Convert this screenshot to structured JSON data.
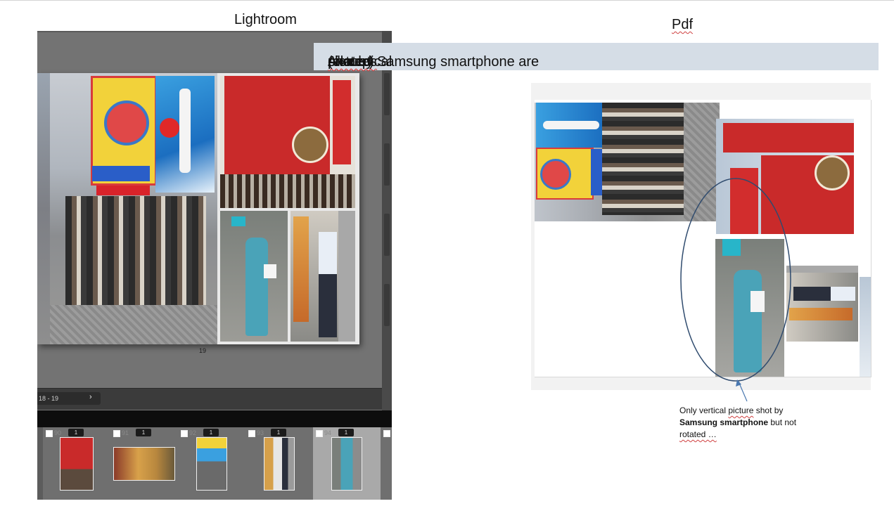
{
  "headings": {
    "lightroom": "Lightroom",
    "pdf": "Pdf"
  },
  "banner": {
    "text_before": "All vertical ",
    "text_squiggle1": "pictures",
    "text_mid": " shot by Samsung smartphone are ",
    "text_squiggle2": "rotated",
    "text_space": " ",
    "text_squiggle3": "(except",
    "text_after": " one …)"
  },
  "lightroom": {
    "page_number": "19",
    "page_nav": "18  -  19",
    "page_nav_arrow": "›",
    "filmstrip": [
      {
        "num": "90",
        "badge": "1",
        "selected": false
      },
      {
        "num": "91",
        "badge": "1",
        "selected": false
      },
      {
        "num": "92",
        "badge": "1",
        "selected": false
      },
      {
        "num": "93",
        "badge": "1",
        "selected": false
      },
      {
        "num": "94",
        "badge": "1",
        "selected": true
      }
    ]
  },
  "note": {
    "line1_a": "Only vertical ",
    "line1_b": "picture",
    "line1_c": " shot by",
    "line2_bold": "Samsung smartphone",
    "line2_rest": " but not",
    "line3": "rotated …"
  },
  "colors": {
    "banner_bg": "#d5dde6",
    "annotation_ellipse": "#2f4b6e",
    "arrow": "#4a78b0",
    "lr_panel": "#737373"
  }
}
